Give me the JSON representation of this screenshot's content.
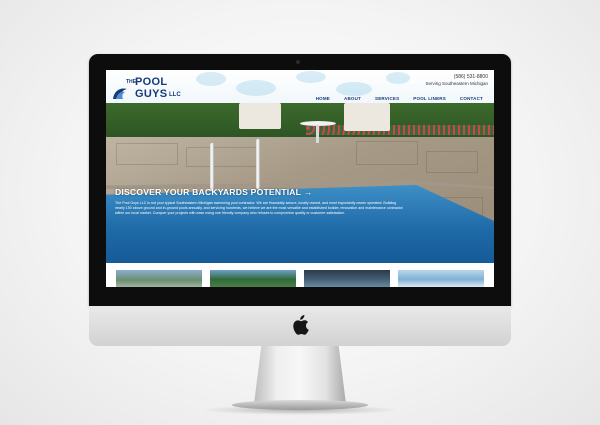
{
  "site": {
    "logo": {
      "line1": "THE",
      "line2": "POOL",
      "line3": "GUYS",
      "suffix": "LLC"
    },
    "phone": "(586) 531-8800",
    "serving": "Serving Southeastern Michigan",
    "nav": [
      "HOME",
      "ABOUT",
      "SERVICES",
      "POOL LINERS",
      "CONTACT"
    ],
    "hero": {
      "headline": "DISCOVER YOUR BACKYARDS POTENTIAL →",
      "body": "The Pool Guys LLC is not your typical Southeastern Michigan swimming pool contractor. We are financially secure, locally owned, and most importantly owner operated. Building nearly 150 above ground and in-ground pools annually, and servicing hundreds, we believe we are the most versatile and established builder, renovation and maintenance contractor within our local market. Conquer your projects with ease using one friendly company who refuses to compromise quality or customer satisfaction."
    },
    "thumbnails": [
      "thumbnail-1",
      "thumbnail-2",
      "thumbnail-3",
      "thumbnail-4"
    ]
  },
  "colors": {
    "brand": "#143a7a",
    "pool": "#1f6aa8",
    "bezel": "#0d0d0d"
  },
  "icons": {
    "device_logo": "apple-logo-icon",
    "brand_wave": "wave-icon"
  }
}
